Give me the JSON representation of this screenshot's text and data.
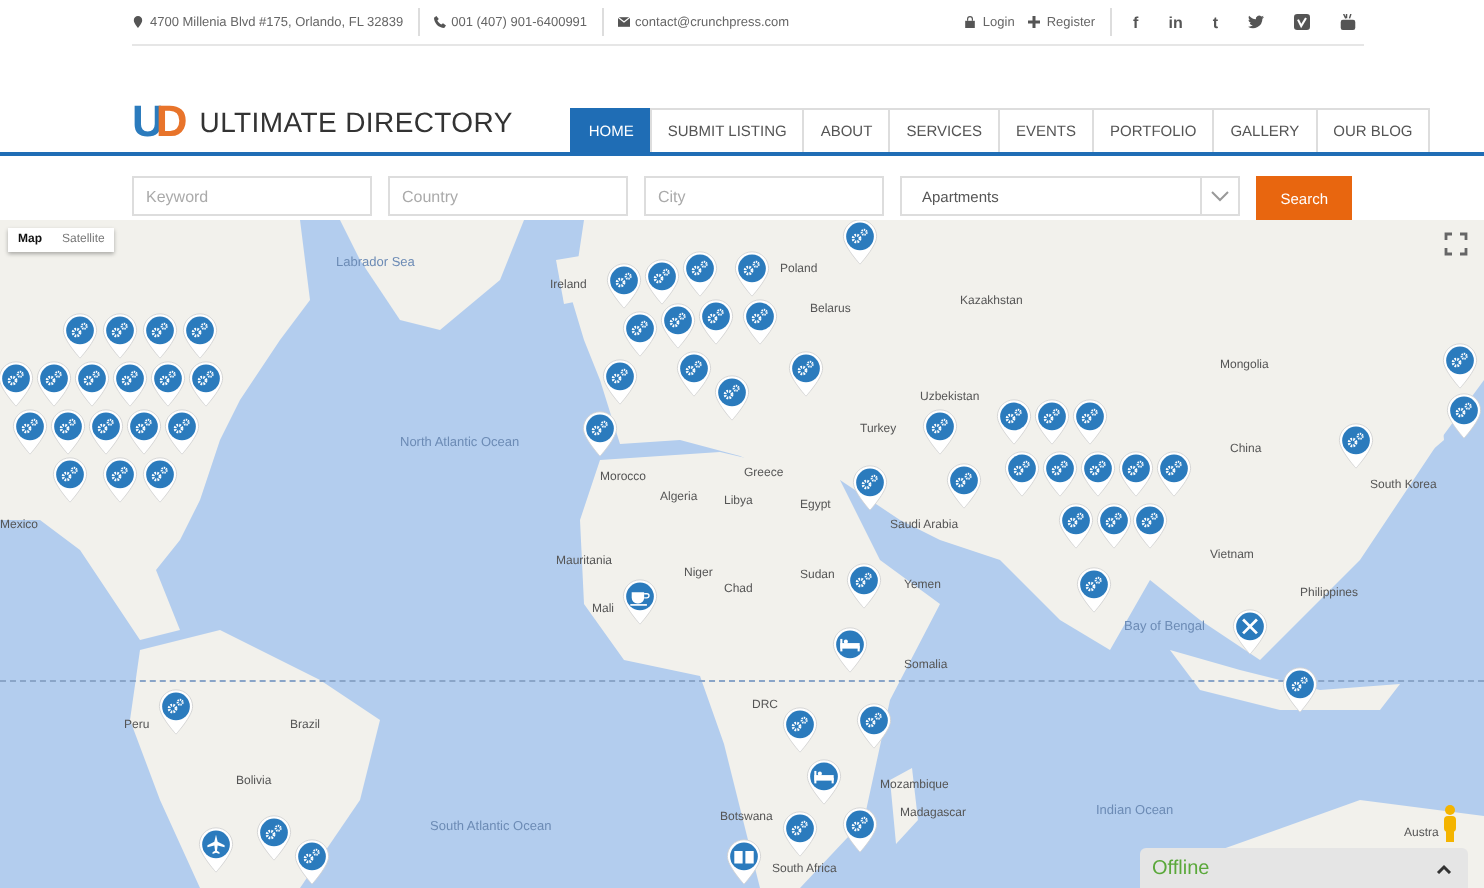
{
  "topbar": {
    "address": "4700 Millenia Blvd #175, Orlando, FL 32839",
    "phone": "001 (407) 901-6400991",
    "email": "contact@crunchpress.com",
    "login": "Login",
    "register": "Register",
    "social": [
      {
        "kind": "letter",
        "text": "f"
      },
      {
        "kind": "letter",
        "text": "in"
      },
      {
        "kind": "letter",
        "text": "t"
      },
      {
        "kind": "bird"
      },
      {
        "kind": "square"
      },
      {
        "kind": "tube"
      }
    ]
  },
  "logo": {
    "mark_left": "U",
    "mark_right": "D",
    "text": "ULTIMATE DIRECTORY"
  },
  "nav": [
    {
      "label": "HOME",
      "selected": true
    },
    {
      "label": "SUBMIT LISTING",
      "selected": false
    },
    {
      "label": "ABOUT",
      "selected": false
    },
    {
      "label": "SERVICES",
      "selected": false
    },
    {
      "label": "EVENTS",
      "selected": false
    },
    {
      "label": "PORTFOLIO",
      "selected": false
    },
    {
      "label": "GALLERY",
      "selected": false
    },
    {
      "label": "OUR BLOG",
      "selected": false
    }
  ],
  "search": {
    "fields": [
      {
        "placeholder": "Keyword"
      },
      {
        "placeholder": "Country"
      },
      {
        "placeholder": "City"
      }
    ],
    "category": "Apartments",
    "button": "Search"
  },
  "map": {
    "types": [
      {
        "label": "Map",
        "selected": true
      },
      {
        "label": "Satellite",
        "selected": false
      }
    ],
    "labels": [
      {
        "text": "Labrador Sea",
        "kind": "water"
      },
      {
        "text": "North Atlantic Ocean",
        "kind": "water"
      },
      {
        "text": "South Atlantic Ocean",
        "kind": "water"
      },
      {
        "text": "Indian Ocean",
        "kind": "water"
      },
      {
        "text": "Ireland",
        "kind": "land"
      },
      {
        "text": "Poland",
        "kind": "land"
      },
      {
        "text": "Belarus",
        "kind": "land"
      },
      {
        "text": "Kazakhstan",
        "kind": "land"
      },
      {
        "text": "Mongolia",
        "kind": "land"
      },
      {
        "text": "Uzbekistan",
        "kind": "land"
      },
      {
        "text": "China",
        "kind": "land"
      },
      {
        "text": "Turkey",
        "kind": "land"
      },
      {
        "text": "Greece",
        "kind": "land"
      },
      {
        "text": "Morocco",
        "kind": "land"
      },
      {
        "text": "Algeria",
        "kind": "land"
      },
      {
        "text": "Libya",
        "kind": "land"
      },
      {
        "text": "Egypt",
        "kind": "land"
      },
      {
        "text": "Saudi Arabia",
        "kind": "land"
      },
      {
        "text": "Mauritania",
        "kind": "land"
      },
      {
        "text": "Mali",
        "kind": "land"
      },
      {
        "text": "Niger",
        "kind": "land"
      },
      {
        "text": "Chad",
        "kind": "land"
      },
      {
        "text": "Sudan",
        "kind": "land"
      },
      {
        "text": "Yemen",
        "kind": "land"
      },
      {
        "text": "Somalia",
        "kind": "land"
      },
      {
        "text": "DRC",
        "kind": "land"
      },
      {
        "text": "Mozambique",
        "kind": "land"
      },
      {
        "text": "Botswana",
        "kind": "land"
      },
      {
        "text": "Madagascar",
        "kind": "land"
      },
      {
        "text": "South Africa",
        "kind": "land"
      },
      {
        "text": "Mexico",
        "kind": "land"
      },
      {
        "text": "Brazil",
        "kind": "land"
      },
      {
        "text": "Bolivia",
        "kind": "land"
      },
      {
        "text": "Peru",
        "kind": "land"
      },
      {
        "text": "South Korea",
        "kind": "land"
      },
      {
        "text": "Vietnam",
        "kind": "land"
      },
      {
        "text": "Philippines",
        "kind": "land"
      },
      {
        "text": "Bay of Bengal",
        "kind": "water"
      },
      {
        "text": "Austra",
        "kind": "land"
      }
    ],
    "markers": [
      {
        "kind": "gear"
      },
      {
        "kind": "gear"
      },
      {
        "kind": "gear"
      },
      {
        "kind": "gear"
      },
      {
        "kind": "gear"
      },
      {
        "kind": "gear"
      },
      {
        "kind": "gear"
      },
      {
        "kind": "gear"
      },
      {
        "kind": "gear"
      },
      {
        "kind": "gear"
      },
      {
        "kind": "gear"
      },
      {
        "kind": "gear"
      },
      {
        "kind": "gear"
      },
      {
        "kind": "gear"
      },
      {
        "kind": "gear"
      },
      {
        "kind": "gear"
      },
      {
        "kind": "gear"
      },
      {
        "kind": "gear"
      },
      {
        "kind": "gear"
      },
      {
        "kind": "gear"
      },
      {
        "kind": "gear"
      },
      {
        "kind": "gear"
      },
      {
        "kind": "gear"
      },
      {
        "kind": "gear"
      },
      {
        "kind": "gear"
      },
      {
        "kind": "gear"
      },
      {
        "kind": "gear"
      },
      {
        "kind": "gear"
      },
      {
        "kind": "gear"
      },
      {
        "kind": "gear"
      },
      {
        "kind": "gear"
      },
      {
        "kind": "gear"
      },
      {
        "kind": "gear"
      },
      {
        "kind": "gear"
      },
      {
        "kind": "gear"
      },
      {
        "kind": "gear"
      },
      {
        "kind": "gear"
      },
      {
        "kind": "gear"
      },
      {
        "kind": "gear"
      },
      {
        "kind": "gear"
      },
      {
        "kind": "gear"
      },
      {
        "kind": "gear"
      },
      {
        "kind": "gear"
      },
      {
        "kind": "gear"
      },
      {
        "kind": "gear"
      },
      {
        "kind": "gear"
      },
      {
        "kind": "gear"
      },
      {
        "kind": "gear"
      },
      {
        "kind": "cup"
      },
      {
        "kind": "bed"
      },
      {
        "kind": "gear"
      },
      {
        "kind": "bed"
      },
      {
        "kind": "gear"
      },
      {
        "kind": "gear"
      },
      {
        "kind": "gear"
      },
      {
        "kind": "book"
      },
      {
        "kind": "gear"
      },
      {
        "kind": "plane"
      },
      {
        "kind": "gear"
      },
      {
        "kind": "gear"
      },
      {
        "kind": "gear"
      },
      {
        "kind": "gear"
      },
      {
        "kind": "gear"
      },
      {
        "kind": "tools"
      },
      {
        "kind": "gear"
      }
    ]
  },
  "chat": {
    "status": "Offline"
  }
}
